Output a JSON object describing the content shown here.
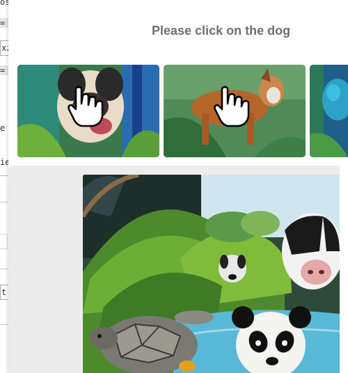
{
  "captcha": {
    "prompt": "Please click on the dog",
    "choices": [
      {
        "subject": "dog-portrait-image"
      },
      {
        "subject": "brown-dog-image"
      },
      {
        "subject": "bird-partial-image"
      }
    ]
  },
  "background_page": {
    "fragments": [
      "os",
      "=",
      "xz",
      "=",
      "e F",
      "ie",
      "t"
    ]
  },
  "colors": {
    "prompt_text": "#6f6f6f",
    "preview_background": "#ececec"
  }
}
